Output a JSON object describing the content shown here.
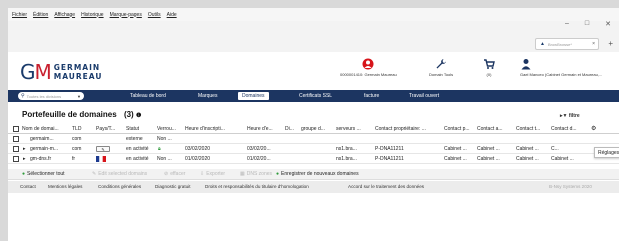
{
  "menubar": [
    "Fichier",
    "Édition",
    "Affichage",
    "Historique",
    "Marque-pages",
    "Outils",
    "Aide"
  ],
  "window_controls": {
    "minimize": "–",
    "maximize": "□",
    "close": "✕"
  },
  "tab": {
    "title": "BrowBrowse*",
    "close": "×"
  },
  "new_tab": "+",
  "logo": {
    "line1": "GERMAIN",
    "line2": "MAUREAU"
  },
  "header": {
    "account": "0000001410: Germain Maureau",
    "tools": "Domain Tools",
    "cart": "(0)",
    "user": "Gael Manceo (Cabinet Germain et Maureau,..."
  },
  "nav": {
    "search_placeholder": "Toutes les divisions",
    "items": [
      "Tableau de bord",
      "Marques",
      "Domaines",
      "Certificats SSL",
      "facture",
      "Travail ouvert"
    ],
    "active": "Domaines"
  },
  "page_title": "Portefeuille de domaines",
  "count": "(3)",
  "filter_label": "filtre",
  "columns": [
    "Nom de domai...",
    "TLD",
    "Pays/T...",
    "Statut",
    "Verrou...",
    "Heure d'inscripti...",
    "Heure d'e...",
    "Di...",
    "groupe d...",
    "serveurs ...",
    "Contact propriétaire: ...",
    "Contact p...",
    "Contact a...",
    "Contact t...",
    "Contact d..."
  ],
  "rows": [
    {
      "name": "germaim...",
      "tld": "com",
      "country": "",
      "status": "externe",
      "lock": "Non ...",
      "reg": "",
      "exp": "",
      "di": "",
      "group": "",
      "servers": "",
      "owner": "",
      "cp": "",
      "ca": "",
      "ct": "",
      "cd": ""
    },
    {
      "name": "germain-m...",
      "tld": "com",
      "country": "",
      "status": "en activité",
      "lock": "",
      "reg": "03/02/2020",
      "exp": "03/02/20...",
      "di": "",
      "group": "",
      "servers": "ns1.bra...",
      "owner": "P-DNA11211",
      "cp": "Cabinet ...",
      "ca": "Cabinet ...",
      "ct": "Cabinet ...",
      "cd": "C..."
    },
    {
      "name": "gm-dns.fr",
      "tld": "fr",
      "country": "",
      "status": "en activité",
      "lock": "Non ...",
      "reg": "01/02/2020",
      "exp": "01/02/20...",
      "di": "",
      "group": "",
      "servers": "ns1.bra...",
      "owner": "P-DNA11211",
      "cp": "Cabinet ...",
      "ca": "Cabinet ...",
      "ct": "Cabinet ...",
      "cd": "Cabinet ..."
    }
  ],
  "settings_popup": "Réglages",
  "toolbar": {
    "select": "Sélectionner tout",
    "edit": "Edit selected domains",
    "delete": "effacer",
    "export": "Exporter",
    "dns": "DNS zones",
    "register": "Enregistrer de nouveaux domaines"
  },
  "footer": [
    "Contact",
    "Mentions légales",
    "Conditions générales",
    "Diagnostic gratuit",
    "Droits et responsabilités du titulaire d'homologation",
    "Accord sur le traitement des données"
  ],
  "footer_right": "B-Nsy Systems 2020",
  "colors": {
    "nav": "#1c3561",
    "brand_red": "#c8202f",
    "lock_green": "#2e9b3a"
  }
}
